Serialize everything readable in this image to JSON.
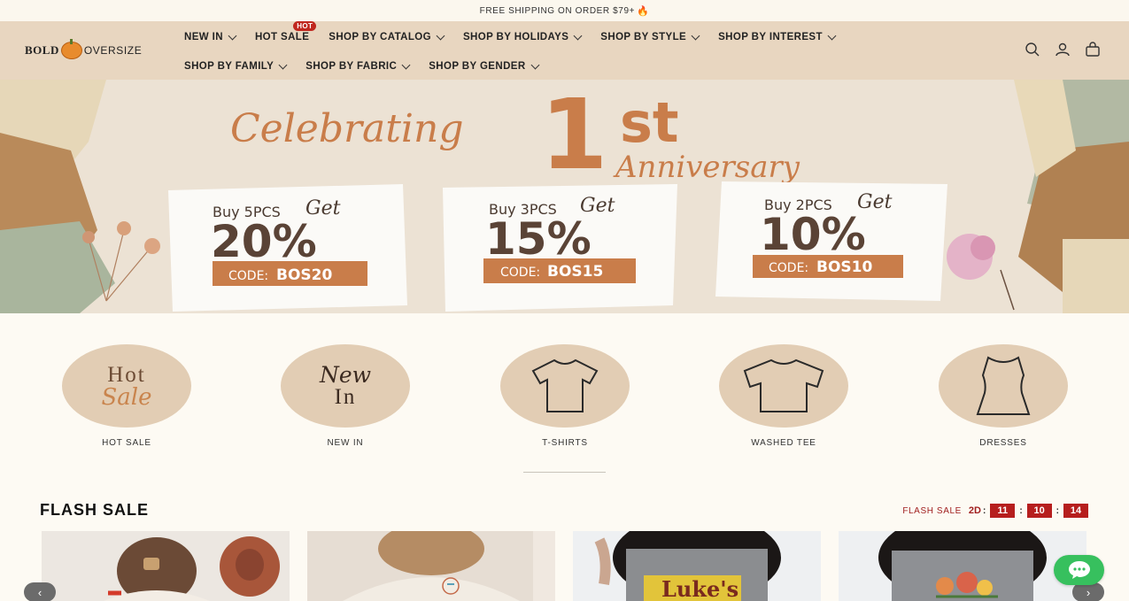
{
  "announcement": {
    "text": "FREE SHIPPING ON ORDER $79+",
    "icon": "fire-icon"
  },
  "logo": {
    "bold": "BOLD",
    "thin": "OVERSIZE"
  },
  "nav": {
    "row1": [
      {
        "label": "NEW IN",
        "chevron": true
      },
      {
        "label": "HOT SALE",
        "chevron": false,
        "badge": "HOT"
      },
      {
        "label": "SHOP BY CATALOG",
        "chevron": true
      },
      {
        "label": "SHOP BY HOLIDAYS",
        "chevron": true
      },
      {
        "label": "SHOP BY STYLE",
        "chevron": true
      },
      {
        "label": "SHOP BY INTEREST",
        "chevron": true
      }
    ],
    "row2": [
      {
        "label": "SHOP BY FAMILY",
        "chevron": true
      },
      {
        "label": "SHOP BY FABRIC",
        "chevron": true
      },
      {
        "label": "SHOP BY GENDER",
        "chevron": true
      }
    ]
  },
  "header_icons": [
    "search-icon",
    "account-icon",
    "cart-icon"
  ],
  "hero": {
    "headline_script": "Celebrating",
    "headline_big": "1",
    "headline_sup": "st",
    "headline_script2": "Anniversary",
    "offers": [
      {
        "buy": "Buy 5PCS",
        "get": "Get",
        "discount": "20%",
        "code_label": "CODE:",
        "code": "BOS20"
      },
      {
        "buy": "Buy 3PCS",
        "get": "Get",
        "discount": "15%",
        "code_label": "CODE:",
        "code": "BOS15"
      },
      {
        "buy": "Buy 2PCS",
        "get": "Get",
        "discount": "10%",
        "code_label": "CODE:",
        "code": "BOS10"
      }
    ]
  },
  "categories": [
    {
      "label": "HOT SALE",
      "art_top": "Hot",
      "art_bottom": "Sale"
    },
    {
      "label": "NEW IN",
      "art_top": "New",
      "art_bottom": "In"
    },
    {
      "label": "T-SHIRTS",
      "icon": "tshirt-icon"
    },
    {
      "label": "WASHED TEE",
      "icon": "tshirt-icon"
    },
    {
      "label": "DRESSES",
      "icon": "dress-icon"
    }
  ],
  "flash_sale": {
    "title": "FLASH SALE",
    "countdown_label": "FLASH SALE",
    "days": "2D",
    "hours": "11",
    "minutes": "10",
    "seconds": "14"
  },
  "products_visible": 4,
  "colors": {
    "header_bg": "#e8d6c0",
    "accent": "#c97d4a",
    "flash_red": "#b61e1e",
    "chat_green": "#37c05e"
  }
}
